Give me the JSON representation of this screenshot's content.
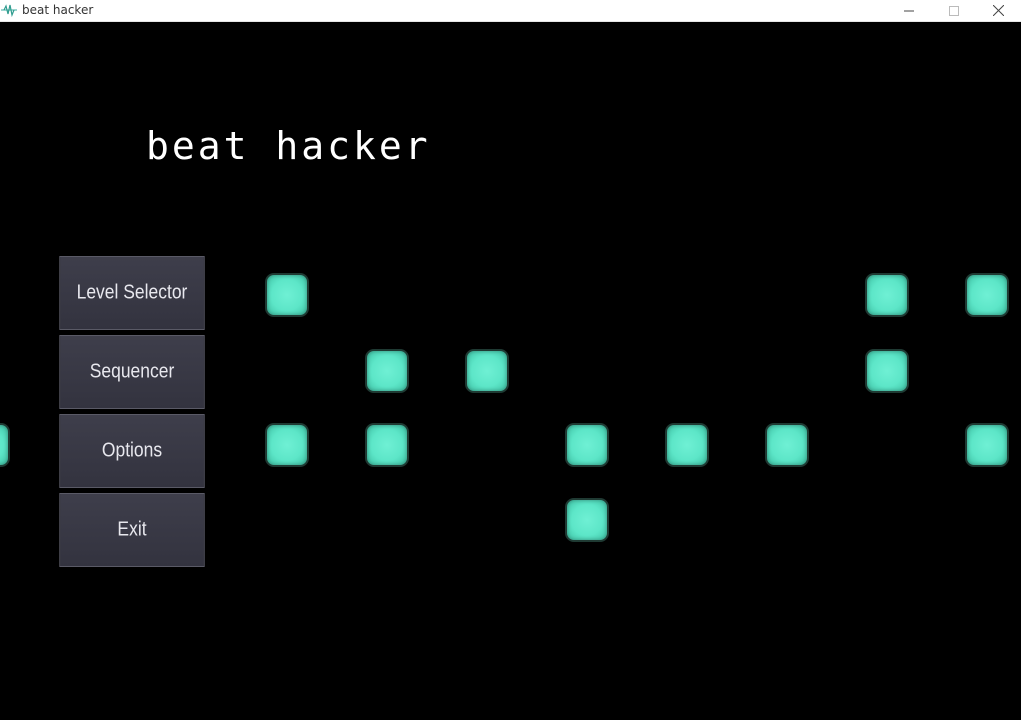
{
  "window": {
    "title": "beat hacker",
    "icon": "waveform-icon",
    "controls": [
      "minimize",
      "maximize",
      "close"
    ]
  },
  "game": {
    "title": "beat hacker"
  },
  "menu": {
    "items": [
      {
        "label": "Level Selector"
      },
      {
        "label": "Sequencer"
      },
      {
        "label": "Options"
      },
      {
        "label": "Exit"
      }
    ]
  },
  "beat_pattern": {
    "color": "#5ee8c9",
    "rows": 4,
    "active_cells": [
      {
        "row": 0,
        "col": 0
      },
      {
        "row": 0,
        "col": 6
      },
      {
        "row": 0,
        "col": 7
      },
      {
        "row": 1,
        "col": 1
      },
      {
        "row": 1,
        "col": 2
      },
      {
        "row": 1,
        "col": 6
      },
      {
        "row": 2,
        "col": -3
      },
      {
        "row": 2,
        "col": 0
      },
      {
        "row": 2,
        "col": 1
      },
      {
        "row": 2,
        "col": 3
      },
      {
        "row": 2,
        "col": 4
      },
      {
        "row": 2,
        "col": 5
      },
      {
        "row": 2,
        "col": 7
      },
      {
        "row": 3,
        "col": 3
      }
    ]
  }
}
